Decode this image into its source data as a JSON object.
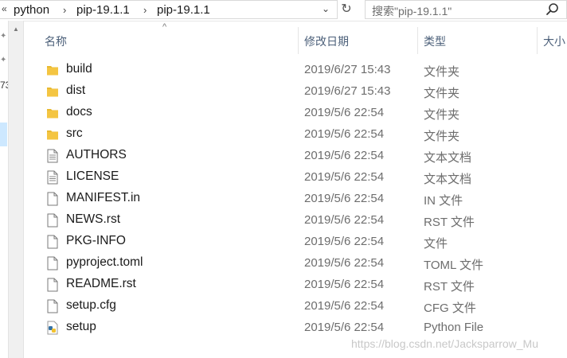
{
  "address_bar": {
    "overflow_glyph": "«",
    "crumbs": [
      "python",
      "pip-19.1.1",
      "pip-19.1.1"
    ],
    "separator": "›",
    "dropdown_glyph": "⌄",
    "refresh_glyph": "↻"
  },
  "search": {
    "placeholder": "搜索\"pip-19.1.1\""
  },
  "nav_fragment": "73",
  "columns": {
    "name": "名称",
    "modified": "修改日期",
    "type": "类型",
    "size": "大小",
    "sort_arrow": "^"
  },
  "files": [
    {
      "name": "build",
      "date": "2019/6/27 15:43",
      "type": "文件夹",
      "icon": "folder-icon"
    },
    {
      "name": "dist",
      "date": "2019/6/27 15:43",
      "type": "文件夹",
      "icon": "folder-icon"
    },
    {
      "name": "docs",
      "date": "2019/5/6 22:54",
      "type": "文件夹",
      "icon": "folder-icon"
    },
    {
      "name": "src",
      "date": "2019/5/6 22:54",
      "type": "文件夹",
      "icon": "folder-icon"
    },
    {
      "name": "AUTHORS",
      "date": "2019/5/6 22:54",
      "type": "文本文档",
      "icon": "text-document-icon"
    },
    {
      "name": "LICENSE",
      "date": "2019/5/6 22:54",
      "type": "文本文档",
      "icon": "text-document-icon"
    },
    {
      "name": "MANIFEST.in",
      "date": "2019/5/6 22:54",
      "type": "IN 文件",
      "icon": "file-icon"
    },
    {
      "name": "NEWS.rst",
      "date": "2019/5/6 22:54",
      "type": "RST 文件",
      "icon": "file-icon"
    },
    {
      "name": "PKG-INFO",
      "date": "2019/5/6 22:54",
      "type": "文件",
      "icon": "file-icon"
    },
    {
      "name": "pyproject.toml",
      "date": "2019/5/6 22:54",
      "type": "TOML 文件",
      "icon": "file-icon"
    },
    {
      "name": "README.rst",
      "date": "2019/5/6 22:54",
      "type": "RST 文件",
      "icon": "file-icon"
    },
    {
      "name": "setup.cfg",
      "date": "2019/5/6 22:54",
      "type": "CFG 文件",
      "icon": "file-icon"
    },
    {
      "name": "setup",
      "date": "2019/5/6 22:54",
      "type": "Python File",
      "icon": "python-file-icon"
    }
  ],
  "watermark": "https://blog.csdn.net/Jacksparrow_Mu",
  "colors": {
    "folder": "#f4c542",
    "selection": "#cde8ff",
    "header_text": "#4c607a",
    "secondary_text": "#6d6d6d"
  }
}
